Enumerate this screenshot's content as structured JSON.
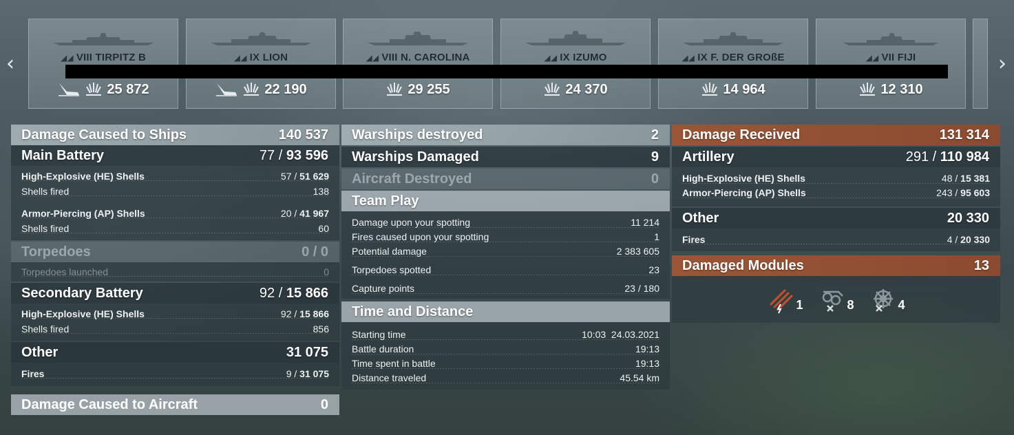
{
  "nav": {
    "prev": "‹",
    "next": "›"
  },
  "ships": [
    {
      "tier": "VIII",
      "name": "TIRPITZ B",
      "torpedo": true,
      "damage": "25 872"
    },
    {
      "tier": "IX",
      "name": "LION",
      "torpedo": true,
      "damage": "22 190"
    },
    {
      "tier": "VIII",
      "name": "N. CAROLINA",
      "torpedo": false,
      "damage": "29 255"
    },
    {
      "tier": "IX",
      "name": "IZUMO",
      "torpedo": false,
      "damage": "24 370"
    },
    {
      "tier": "IX",
      "name": "F. DER GROßE",
      "torpedo": false,
      "damage": "14 964"
    },
    {
      "tier": "VII",
      "name": "FIJI",
      "torpedo": false,
      "damage": "12 310"
    }
  ],
  "left": {
    "ships_hdr": {
      "label": "Damage Caused to Ships",
      "value": "140 537"
    },
    "main_battery": {
      "label": "Main Battery",
      "hits": "77",
      "dmg": "93 596"
    },
    "he": {
      "label": "High-Explosive (HE) Shells",
      "hits": "57",
      "dmg": "51 629"
    },
    "he_fired": {
      "label": "Shells fired",
      "value": "138"
    },
    "ap": {
      "label": "Armor-Piercing (AP) Shells",
      "hits": "20",
      "dmg": "41 967"
    },
    "ap_fired": {
      "label": "Shells fired",
      "value": "60"
    },
    "torpedoes": {
      "label": "Torpedoes",
      "value": "0 / 0"
    },
    "torp_launched": {
      "label": "Torpedoes launched",
      "value": "0"
    },
    "secondary": {
      "label": "Secondary Battery",
      "hits": "92",
      "dmg": "15 866"
    },
    "sec_he": {
      "label": "High-Explosive (HE) Shells",
      "hits": "92",
      "dmg": "15 866"
    },
    "sec_fired": {
      "label": "Shells fired",
      "value": "856"
    },
    "other": {
      "label": "Other",
      "value": "31 075"
    },
    "fires": {
      "label": "Fires",
      "hits": "9",
      "dmg": "31 075"
    },
    "aircraft": {
      "label": "Damage Caused to Aircraft",
      "value": "0"
    }
  },
  "center": {
    "destroyed": {
      "label": "Warships destroyed",
      "value": "2"
    },
    "damaged": {
      "label": "Warships Damaged",
      "value": "9"
    },
    "aircraft": {
      "label": "Aircraft Destroyed",
      "value": "0"
    },
    "team": {
      "label": "Team Play"
    },
    "spot_dmg": {
      "label": "Damage upon your spotting",
      "value": "11 214"
    },
    "spot_fires": {
      "label": "Fires caused upon your spotting",
      "value": "1"
    },
    "potential": {
      "label": "Potential damage",
      "value": "2 383 605"
    },
    "torp_spotted": {
      "label": "Torpedoes spotted",
      "value": "23"
    },
    "capture": {
      "label": "Capture points",
      "value": "23 / 180"
    },
    "time": {
      "label": "Time and Distance"
    },
    "start": {
      "label": "Starting time",
      "value": "10:03  24.03.2021"
    },
    "duration": {
      "label": "Battle duration",
      "value": "19:13"
    },
    "spent": {
      "label": "Time spent in battle",
      "value": "19:13"
    },
    "distance": {
      "label": "Distance traveled",
      "value": "45.54 km"
    }
  },
  "right": {
    "received": {
      "label": "Damage Received",
      "value": "131 314"
    },
    "artillery": {
      "label": "Artillery",
      "hits": "291",
      "dmg": "110 984"
    },
    "he": {
      "label": "High-Explosive (HE) Shells",
      "hits": "48",
      "dmg": "15 381"
    },
    "ap": {
      "label": "Armor-Piercing (AP) Shells",
      "hits": "243",
      "dmg": "95 603"
    },
    "other": {
      "label": "Other",
      "value": "20 330"
    },
    "fires": {
      "label": "Fires",
      "hits": "4",
      "dmg": "20 330"
    },
    "modules": {
      "label": "Damaged Modules",
      "value": "13"
    },
    "module_counts": [
      {
        "icon": "torpedo-tubes-icon",
        "count": "1"
      },
      {
        "icon": "engine-icon",
        "count": "8"
      },
      {
        "icon": "steering-gear-icon",
        "count": "4"
      }
    ]
  },
  "colors": {
    "accent_orange": "#9a5637",
    "panel_dark": "#2c383e"
  }
}
